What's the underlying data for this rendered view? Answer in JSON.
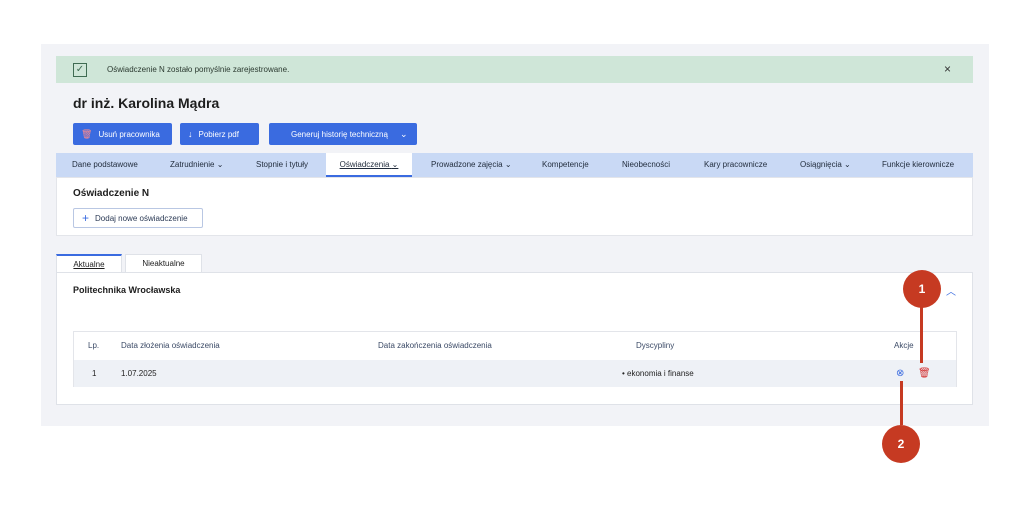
{
  "alert": {
    "message": "Oświadczenie N zostało pomyślnie zarejestrowane.",
    "close": "×",
    "icon": "check-icon"
  },
  "employee": {
    "name": "dr inż. Karolina Mądra"
  },
  "actions": {
    "delete": "Usuń pracownika",
    "download": "Pobierz pdf",
    "history": "Generuj historię techniczną"
  },
  "nav": {
    "tabs": [
      "Dane podstawowe",
      "Zatrudnienie",
      "Stopnie i tytuły",
      "Oświadczenia",
      "Prowadzone zajęcia",
      "Kompetencje",
      "Nieobecności",
      "Kary pracownicze",
      "Osiągnięcia",
      "Funkcje kierownicze"
    ],
    "active": "Oświadczenia",
    "dropdown_tabs": [
      "Zatrudnienie",
      "Oświadczenia",
      "Prowadzone zajęcia",
      "Osiągnięcia"
    ]
  },
  "section": {
    "title": "Oświadczenie N",
    "add_button": "Dodaj nowe oświadczenie"
  },
  "subtabs": [
    "Aktualne",
    "Nieaktualne"
  ],
  "card": {
    "institution": "Politechnika Wrocławska",
    "table": {
      "columns": [
        "Lp.",
        "Data złożenia oświadczenia",
        "Data zakończenia oświadczenia",
        "Dyscypliny",
        "Akcje"
      ],
      "rows": [
        {
          "lp": "1",
          "submitted": "1.07.2025",
          "ended": "",
          "disciplines": "• ekonomia i finanse"
        }
      ]
    }
  },
  "callouts": [
    "1",
    "2"
  ],
  "colors": {
    "accent": "#3a6be0",
    "success_bg": "#cfe6d8",
    "callout": "#c63a22",
    "danger": "#d32f2f"
  }
}
